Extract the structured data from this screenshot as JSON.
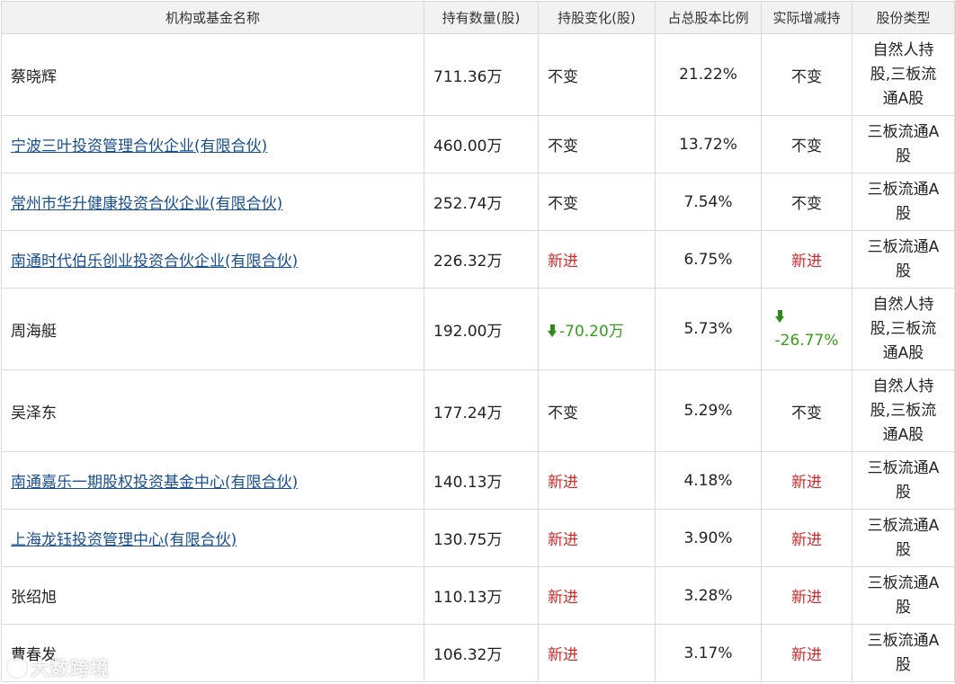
{
  "table": {
    "headers": [
      "机构或基金名称",
      "持有数量(股)",
      "持股变化(股)",
      "占总股本比例",
      "实际增减持",
      "股份类型"
    ],
    "rows": [
      {
        "name": "蔡晓辉",
        "link": false,
        "shares": "711.36万",
        "change": "不变",
        "change_kind": "same",
        "ratio": "21.22%",
        "actual": "不变",
        "actual_kind": "same",
        "type": [
          "自然人持",
          "股,三板流",
          "通A股"
        ]
      },
      {
        "name": "宁波三叶投资管理合伙企业(有限合伙)",
        "link": true,
        "shares": "460.00万",
        "change": "不变",
        "change_kind": "same",
        "ratio": "13.72%",
        "actual": "不变",
        "actual_kind": "same",
        "type": [
          "三板流通A",
          "股"
        ]
      },
      {
        "name": "常州市华升健康投资合伙企业(有限合伙)",
        "link": true,
        "shares": "252.74万",
        "change": "不变",
        "change_kind": "same",
        "ratio": "7.54%",
        "actual": "不变",
        "actual_kind": "same",
        "type": [
          "三板流通A",
          "股"
        ]
      },
      {
        "name": "南通时代伯乐创业投资合伙企业(有限合伙)",
        "link": true,
        "shares": "226.32万",
        "change": "新进",
        "change_kind": "new",
        "ratio": "6.75%",
        "actual": "新进",
        "actual_kind": "new",
        "type": [
          "三板流通A",
          "股"
        ]
      },
      {
        "name": "周海艇",
        "link": false,
        "shares": "192.00万",
        "change": "-70.20万",
        "change_kind": "down",
        "ratio": "5.73%",
        "actual": "-26.77%",
        "actual_kind": "down",
        "type": [
          "自然人持",
          "股,三板流",
          "通A股"
        ]
      },
      {
        "name": "吴泽东",
        "link": false,
        "shares": "177.24万",
        "change": "不变",
        "change_kind": "same",
        "ratio": "5.29%",
        "actual": "不变",
        "actual_kind": "same",
        "type": [
          "自然人持",
          "股,三板流",
          "通A股"
        ]
      },
      {
        "name": "南通嘉乐一期股权投资基金中心(有限合伙)",
        "link": true,
        "shares": "140.13万",
        "change": "新进",
        "change_kind": "new",
        "ratio": "4.18%",
        "actual": "新进",
        "actual_kind": "new",
        "type": [
          "三板流通A",
          "股"
        ]
      },
      {
        "name": "上海龙钰投资管理中心(有限合伙)",
        "link": true,
        "shares": "130.75万",
        "change": "新进",
        "change_kind": "new",
        "ratio": "3.90%",
        "actual": "新进",
        "actual_kind": "new",
        "type": [
          "三板流通A",
          "股"
        ]
      },
      {
        "name": "张绍旭",
        "link": false,
        "shares": "110.13万",
        "change": "新进",
        "change_kind": "new",
        "ratio": "3.28%",
        "actual": "新进",
        "actual_kind": "new",
        "type": [
          "三板流通A",
          "股"
        ]
      },
      {
        "name": "曹春发",
        "link": false,
        "shares": "106.32万",
        "change": "新进",
        "change_kind": "new",
        "ratio": "3.17%",
        "actual": "新进",
        "actual_kind": "new",
        "type": [
          "三板流通A",
          "股"
        ]
      }
    ]
  },
  "colors": {
    "link": "#1a4e8f",
    "new": "#cc2b2b",
    "down": "#3a9b1f",
    "header_bg": "#f2f2f2",
    "border": "#d9d9d9"
  },
  "icons": {
    "down_arrow": "arrow-down-icon",
    "watermark_logo": "watermark-logo-icon"
  },
  "watermark": {
    "text": "大数跨境"
  }
}
